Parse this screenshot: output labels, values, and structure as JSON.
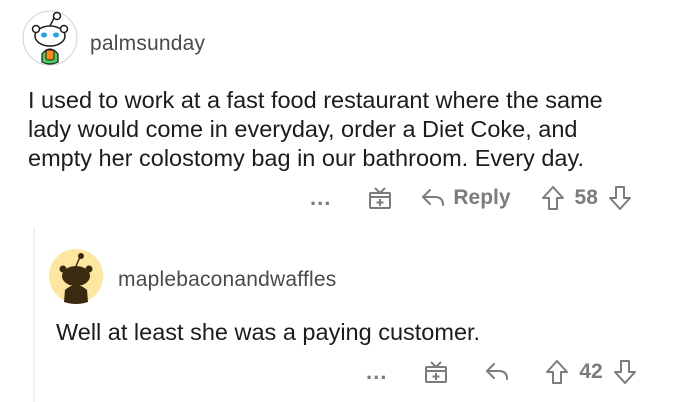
{
  "comments": [
    {
      "username": "palmsunday",
      "text_lines": [
        "I used to work at a fast food restaurant where the same",
        "lady would come in everyday, order a Diet Coke, and",
        "empty her colostomy bag in our bathroom. Every day."
      ],
      "more_label": "...",
      "reply_label": "Reply",
      "score": "58"
    },
    {
      "username": "maplebaconandwaffles",
      "text_lines": [
        "Well at least she was a paying customer."
      ],
      "more_label": "...",
      "score": "42"
    }
  ],
  "colors": {
    "text": "#1c1c1c",
    "muted": "#7c7c7c",
    "thread": "#edeff1",
    "avatar2_bg": "#fce6a0"
  },
  "icons": [
    "snoo-avatar-icon",
    "snoo-avatar-icon",
    "more-icon",
    "award-icon",
    "reply-icon",
    "upvote-icon",
    "downvote-icon"
  ]
}
